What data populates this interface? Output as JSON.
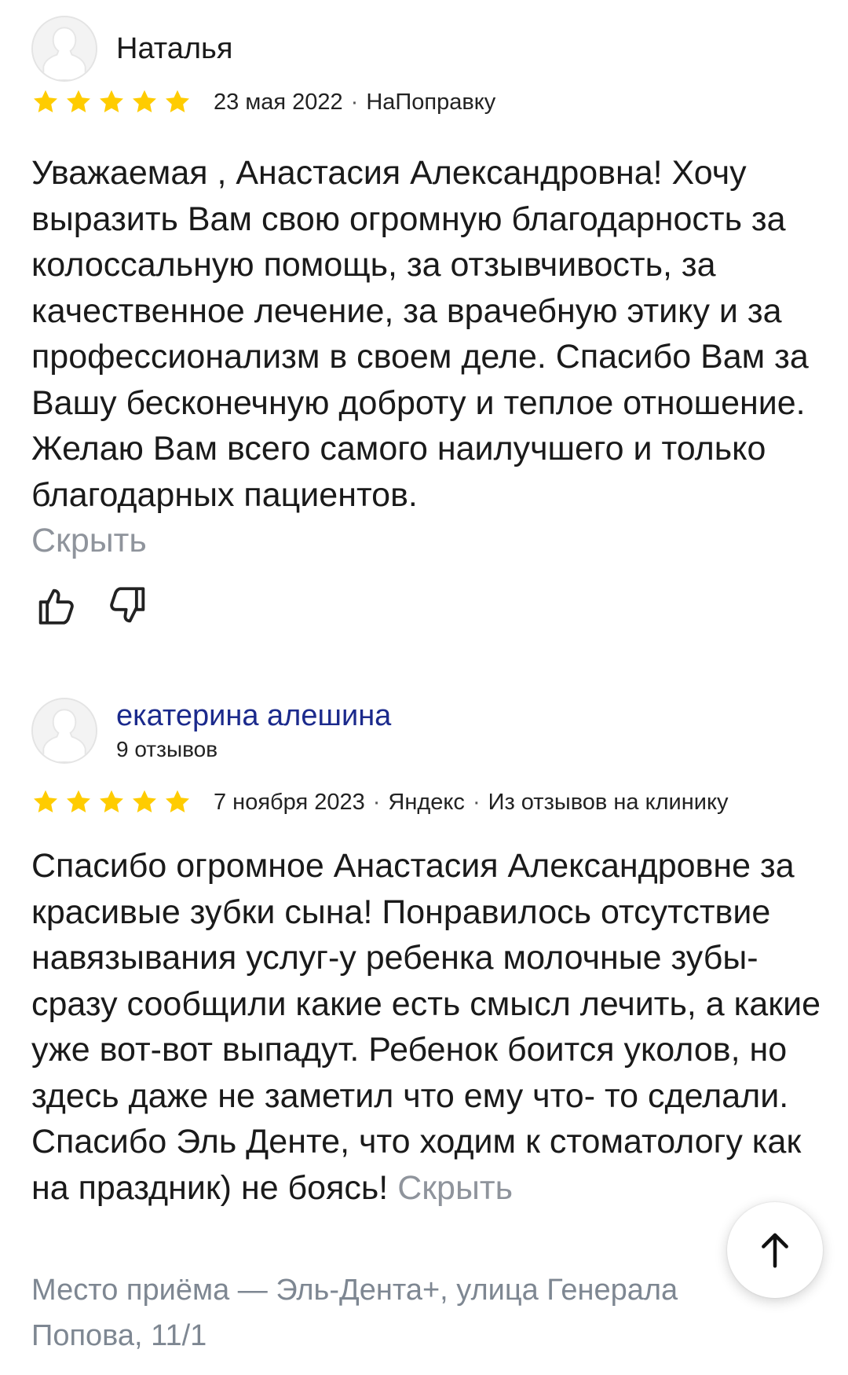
{
  "reviews": [
    {
      "author": "Наталья",
      "rating": 5,
      "date": "23 мая 2022",
      "source": "НаПоправку",
      "text": "Уважаемая , Анастасия Александровна! Хочу выразить Вам свою огромную благодарность за колоссальную помощь, за отзывчивость, за качественное лечение, за врачебную этику и за профессионализм в своем деле. Спасибо Вам за Вашу бесконечную доброту и теплое отношение. Желаю Вам всего самого наилучшего и только благодарных пациентов.",
      "hide_label": "Скрыть"
    },
    {
      "author": "екатерина алешина",
      "reviews_count": "9 отзывов",
      "rating": 5,
      "date": "7 ноября 2023",
      "source": "Яндекс",
      "origin": "Из отзывов на клинику",
      "text": "Спасибо огромное Анастасия Александровне за красивые зубки сына! Понравилось отсутствие навязывания услуг-у ребенка молочные зубы- сразу сообщили какие есть смысл лечить, а какие уже вот-вот выпадут. Ребенок боится уколов, но здесь даже не заметил что ему что- то сделали. Спасибо Эль Денте, что ходим к стоматологу как на праздник) не боясь!",
      "hide_label": "Скрыть",
      "place": "Место приёма — Эль-Дента+, улица Генерала Попова, 11/1"
    }
  ],
  "meta_separator": "·",
  "icons": {
    "star": "star-icon",
    "like": "thumbs-up-icon",
    "dislike": "thumbs-down-icon",
    "scroll_top": "arrow-up-icon",
    "avatar": "user-silhouette-icon"
  },
  "colors": {
    "star": "#ffcc00",
    "author_link": "#1b2a8c",
    "muted": "#8f949c",
    "place": "#7e8792",
    "text": "#1a1a1a"
  }
}
